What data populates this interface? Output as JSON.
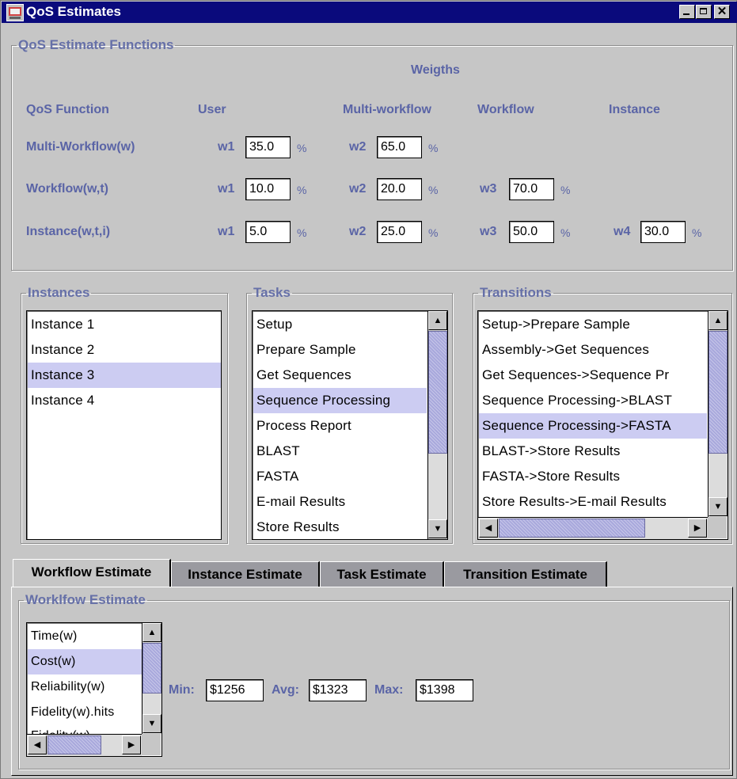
{
  "window": {
    "title": "QoS Estimates"
  },
  "functions_group": {
    "legend": "QoS Estimate Functions",
    "weights_header": "Weigths",
    "columns": {
      "function": "QoS Function",
      "user": "User",
      "multi": "Multi-workflow",
      "workflow": "Workflow",
      "instance": "Instance"
    },
    "rows": [
      {
        "label": "Multi-Workflow(w)",
        "weights": [
          {
            "name": "w1",
            "value": "35.0"
          },
          {
            "name": "w2",
            "value": "65.0"
          }
        ]
      },
      {
        "label": "Workflow(w,t)",
        "weights": [
          {
            "name": "w1",
            "value": "10.0"
          },
          {
            "name": "w2",
            "value": "20.0"
          },
          {
            "name": "w3",
            "value": "70.0"
          }
        ]
      },
      {
        "label": "Instance(w,t,i)",
        "weights": [
          {
            "name": "w1",
            "value": "5.0"
          },
          {
            "name": "w2",
            "value": "25.0"
          },
          {
            "name": "w3",
            "value": "50.0"
          },
          {
            "name": "w4",
            "value": "30.0"
          }
        ]
      }
    ],
    "percent": "%"
  },
  "instances": {
    "legend": "Instances",
    "items": [
      "Instance 1",
      "Instance 2",
      "Instance 3",
      "Instance 4"
    ],
    "selected": "Instance 3"
  },
  "tasks": {
    "legend": "Tasks",
    "items": [
      "Setup",
      "Prepare Sample",
      "Get Sequences",
      "Sequence Processing",
      "Process Report",
      "BLAST",
      "FASTA",
      "E-mail Results",
      "Store Results"
    ],
    "selected": "Sequence Processing"
  },
  "transitions": {
    "legend": "Transitions",
    "items": [
      "Setup->Prepare Sample",
      "Assembly->Get Sequences",
      "Get Sequences->Sequence Pr",
      "Sequence Processing->BLAST",
      "Sequence Processing->FASTA",
      "BLAST->Store Results",
      "FASTA->Store Results",
      "Store Results->E-mail Results"
    ],
    "selected": "Sequence Processing->FASTA"
  },
  "tabs": [
    {
      "label": "Workflow Estimate",
      "active": true
    },
    {
      "label": "Instance Estimate",
      "active": false
    },
    {
      "label": "Task Estimate",
      "active": false
    },
    {
      "label": "Transition Estimate",
      "active": false
    }
  ],
  "estimate": {
    "legend": "Worklfow Estimate",
    "metrics": [
      "Time(w)",
      "Cost(w)",
      "Reliability(w)",
      "Fidelity(w).hits",
      "Fidelity(w)..."
    ],
    "selected": "Cost(w)",
    "min_label": "Min:",
    "min_value": "$1256",
    "avg_label": "Avg:",
    "avg_value": "$1323",
    "max_label": "Max:",
    "max_value": "$1398"
  },
  "colors": {
    "title_bar": "#0a0a7c",
    "label": "#5a64a6",
    "selection": "#ccccf2",
    "panel": "#c6c6c6"
  },
  "icons": {
    "minimize": "minimize-icon",
    "maximize": "maximize-icon",
    "close": "close-icon"
  }
}
